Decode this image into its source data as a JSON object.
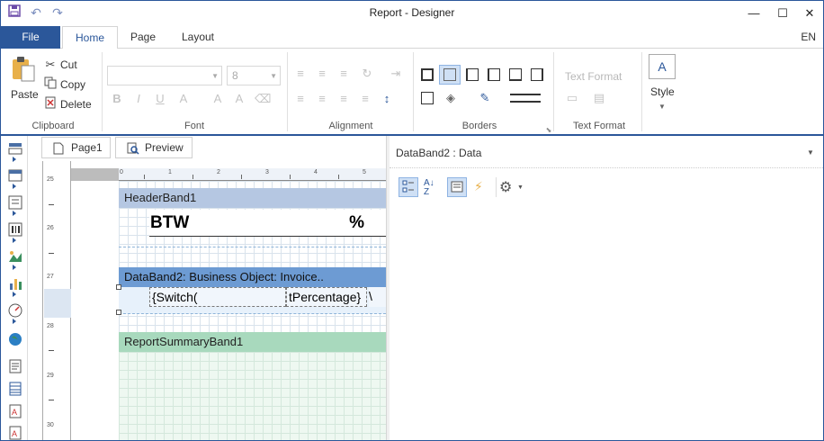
{
  "window": {
    "title": "Report - Designer",
    "minimize_glyph": "—",
    "maximize_glyph": "☐",
    "close_glyph": "✕"
  },
  "tabs": {
    "file": "File",
    "home": "Home",
    "page": "Page",
    "layout": "Layout",
    "language": "EN"
  },
  "ribbon": {
    "clipboard": {
      "paste": "Paste",
      "cut": "Cut",
      "copy": "Copy",
      "delete": "Delete",
      "label": "Clipboard"
    },
    "font": {
      "family_value": "",
      "size_value": "8",
      "bold": "B",
      "italic": "I",
      "underline": "U",
      "label": "Font"
    },
    "alignment": {
      "label": "Alignment"
    },
    "borders": {
      "label": "Borders"
    },
    "text_format": {
      "button": "Text Format",
      "label": "Text Format"
    },
    "style": {
      "button": "Style"
    }
  },
  "page_tabs": {
    "page1": "Page1",
    "preview": "Preview"
  },
  "ruler": {
    "vertical": [
      "25",
      "26",
      "27",
      "28",
      "29",
      "30"
    ],
    "horizontal": [
      "0",
      "1",
      "2",
      "3",
      "4",
      "5"
    ]
  },
  "report": {
    "header_band": "HeaderBand1",
    "header_cells": {
      "btw": "BTW",
      "percent": "%"
    },
    "data_band": "DataBand2: Business Object: Invoice..",
    "data_cells": {
      "switch": "{Switch(",
      "percentage": "tPercentage}",
      "overflow": "\\"
    },
    "summary_band": "ReportSummaryBand1"
  },
  "properties": {
    "selected_object": "DataBand2 : Data"
  },
  "colors": {
    "accent": "#2b579a",
    "header_band": "#b5c7e2",
    "data_band": "#6d9bd3",
    "summary_band": "#a8d9bd"
  }
}
